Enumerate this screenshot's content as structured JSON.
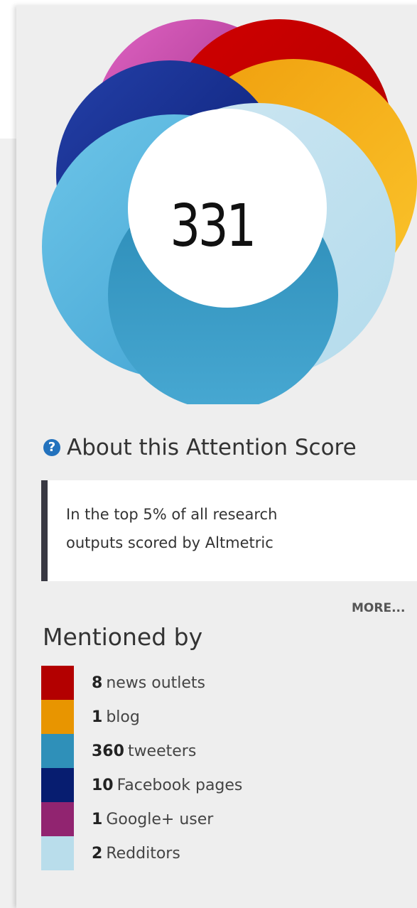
{
  "score": "331",
  "about_label": "About this Attention Score",
  "help_icon": "question-circle-icon",
  "ribbon": {
    "line1": "In the top 5% of all research",
    "line2": "outputs scored by Altmetric"
  },
  "more_label": "MORE...",
  "mentioned_title": "Mentioned by",
  "colors": {
    "news": "#b30000",
    "blog": "#e89500",
    "twitter": "#2f90b9",
    "facebook": "#071d70",
    "google": "#912470",
    "reddit": "#b9ddeb"
  },
  "mentions": [
    {
      "count": "8",
      "label": "news outlets"
    },
    {
      "count": "1",
      "label": "blog"
    },
    {
      "count": "360",
      "label": "tweeters"
    },
    {
      "count": "10",
      "label": "Facebook pages"
    },
    {
      "count": "1",
      "label": "Google+ user"
    },
    {
      "count": "2",
      "label": "Redditors"
    }
  ]
}
